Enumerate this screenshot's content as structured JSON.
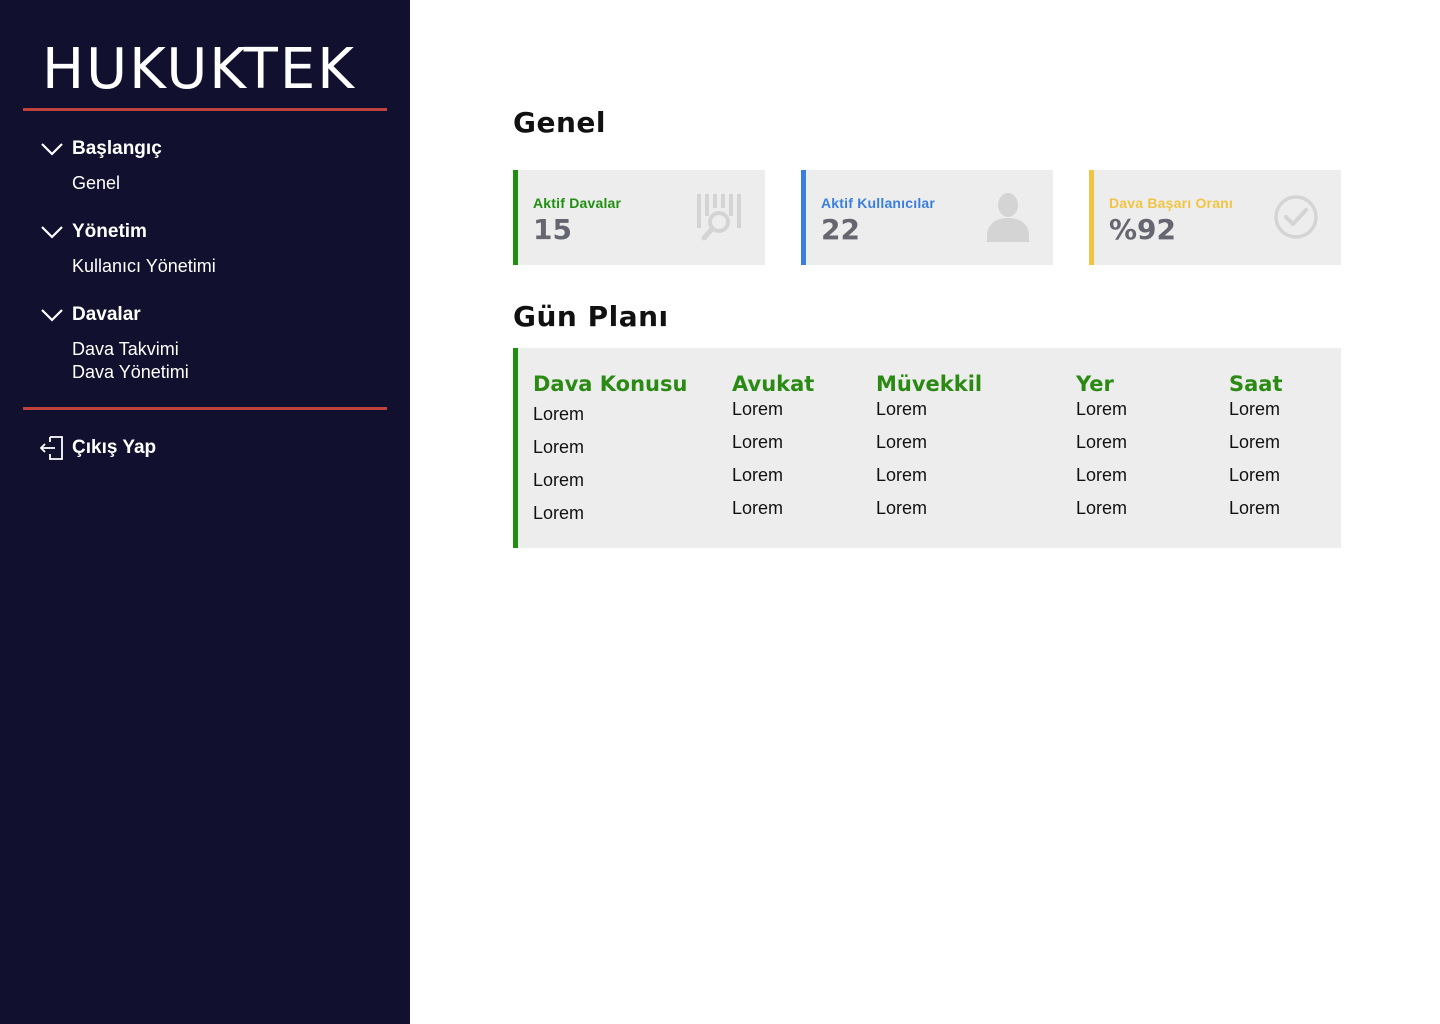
{
  "sidebar": {
    "brand": "HUKUKTEK",
    "groups": [
      {
        "label": "Başlangıç",
        "items": [
          "Genel"
        ]
      },
      {
        "label": "Yönetim",
        "items": [
          "Kullanıcı Yönetimi"
        ]
      },
      {
        "label": "Davalar",
        "items": [
          "Dava Takvimi",
          "Dava Yönetimi"
        ]
      }
    ],
    "logout_label": "Çıkış Yap",
    "divider_color": "#c0423d",
    "background": "#11112f"
  },
  "main": {
    "overview_title": "Genel",
    "cards": [
      {
        "label": "Aktif Davalar",
        "value": "15",
        "accent": "#1f8f0f",
        "icon": "case-search-icon"
      },
      {
        "label": "Aktif Kullanıcılar",
        "value": "22",
        "accent": "#3a7fe0",
        "icon": "user-icon"
      },
      {
        "label": "Dava Başarı Oranı",
        "value": "%92",
        "accent": "#f1c443",
        "icon": "check-circle-icon"
      }
    ],
    "plan_title": "Gün Planı",
    "plan": {
      "accent": "#1f8f0f",
      "columns": [
        "Dava Konusu",
        "Avukat",
        "Müvekkil",
        "Yer",
        "Saat"
      ],
      "rows": [
        [
          "Lorem",
          "Lorem",
          "Lorem",
          "Lorem",
          "Lorem"
        ],
        [
          "Lorem",
          "Lorem",
          "Lorem",
          "Lorem",
          "Lorem"
        ],
        [
          "Lorem",
          "Lorem",
          "Lorem",
          "Lorem",
          "Lorem"
        ],
        [
          "Lorem",
          "Lorem",
          "Lorem",
          "Lorem",
          "Lorem"
        ]
      ]
    }
  }
}
